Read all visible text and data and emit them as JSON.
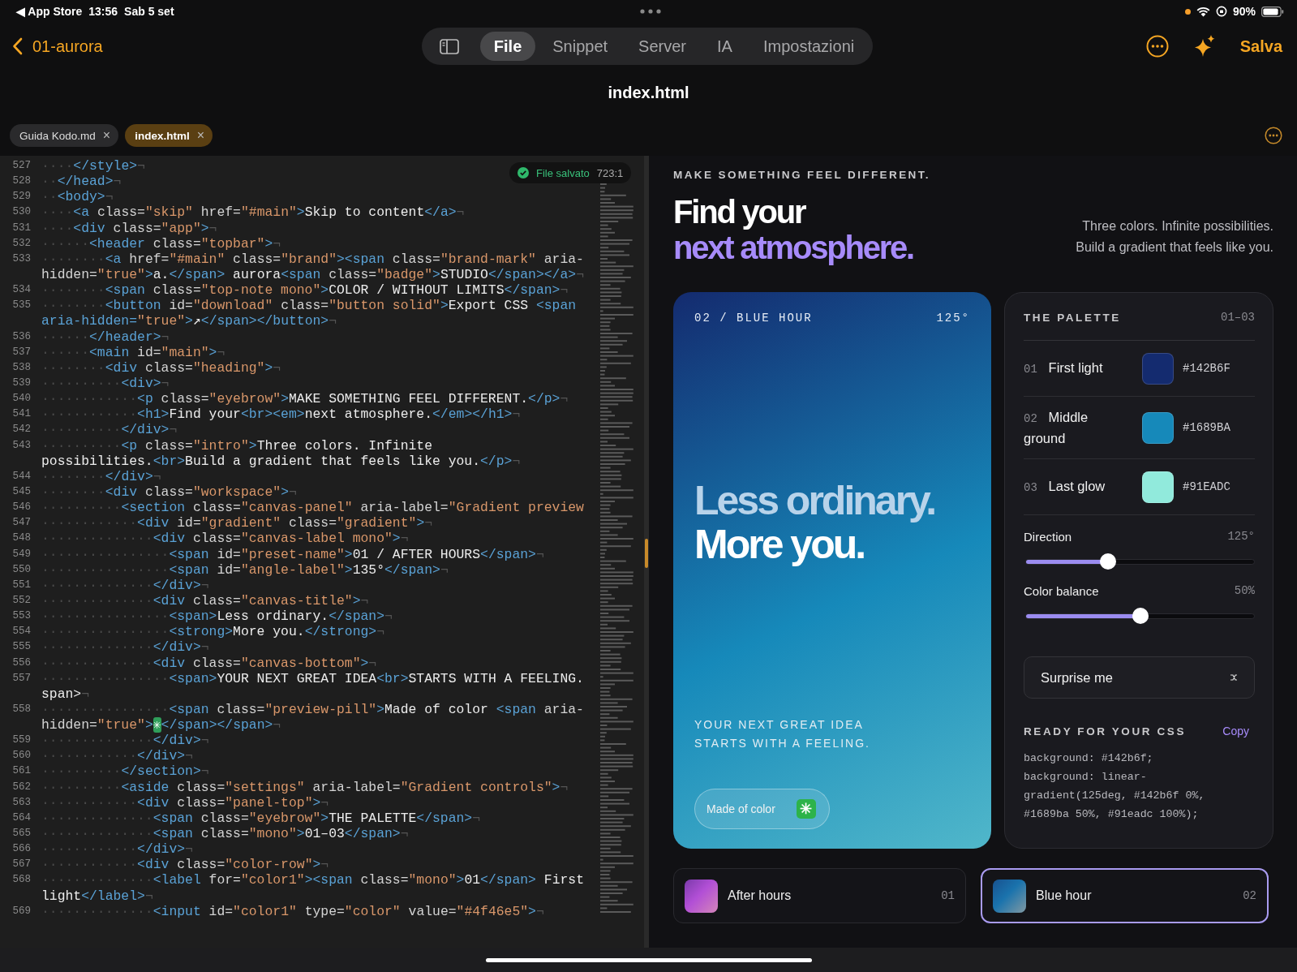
{
  "status_bar": {
    "back_app": "◀ App Store",
    "time": "13:56",
    "date": "Sab 5 set",
    "battery": "90%"
  },
  "nav": {
    "back": "01-aurora",
    "segments": [
      {
        "label": "File",
        "selected": true
      },
      {
        "label": "Snippet",
        "selected": false
      },
      {
        "label": "Server",
        "selected": false
      },
      {
        "label": "IA",
        "selected": false
      },
      {
        "label": "Impostazioni",
        "selected": false
      }
    ],
    "save": "Salva"
  },
  "title": "index.html",
  "file_tabs": [
    {
      "label": "Guida Kodo.md",
      "close": "×",
      "selected": false
    },
    {
      "label": "index.html",
      "close": "×",
      "selected": true
    }
  ],
  "editor": {
    "badge": {
      "text": "File salvato",
      "position": "723:1"
    },
    "lines": [
      {
        "n": "527",
        "rows": [
          "····</style>¬"
        ]
      },
      {
        "n": "528",
        "rows": [
          "··</head>¬"
        ]
      },
      {
        "n": "529",
        "rows": [
          "··<body>¬"
        ]
      },
      {
        "n": "530",
        "rows": [
          "····<a class=\"skip\" href=\"#main\">Skip to content</a>¬"
        ]
      },
      {
        "n": "531",
        "rows": [
          "····<div class=\"app\">¬"
        ]
      },
      {
        "n": "532",
        "rows": [
          "······<header class=\"topbar\">¬"
        ]
      },
      {
        "n": "533",
        "rows": [
          "········<a href=\"#main\" class=\"brand\"><span class=\"brand-mark\" aria-",
          "hidden=\"true\">a.</span> aurora<span class=\"badge\">STUDIO</span></a>¬"
        ]
      },
      {
        "n": "534",
        "rows": [
          "········<span class=\"top-note mono\">COLOR / WITHOUT LIMITS</span>¬"
        ]
      },
      {
        "n": "535",
        "rows": [
          "········<button id=\"download\" class=\"button solid\">Export CSS <span",
          "aria-hidden=\"true\">↗</span></button>¬"
        ]
      },
      {
        "n": "536",
        "rows": [
          "······</header>¬"
        ]
      },
      {
        "n": "537",
        "rows": [
          "······<main id=\"main\">¬"
        ]
      },
      {
        "n": "538",
        "rows": [
          "········<div class=\"heading\">¬"
        ]
      },
      {
        "n": "539",
        "rows": [
          "··········<div>¬"
        ]
      },
      {
        "n": "540",
        "rows": [
          "············<p class=\"eyebrow\">MAKE SOMETHING FEEL DIFFERENT.</p>¬"
        ]
      },
      {
        "n": "541",
        "rows": [
          "············<h1>Find your<br><em>next atmosphere.</em></h1>¬"
        ]
      },
      {
        "n": "542",
        "rows": [
          "··········</div>¬"
        ]
      },
      {
        "n": "543",
        "rows": [
          "··········<p class=\"intro\">Three colors. Infinite",
          "possibilities.<br>Build a gradient that feels like you.</p>¬"
        ]
      },
      {
        "n": "544",
        "rows": [
          "········</div>¬"
        ]
      },
      {
        "n": "545",
        "rows": [
          "········<div class=\"workspace\">¬"
        ]
      },
      {
        "n": "546",
        "rows": [
          "··········<section class=\"canvas-panel\" aria-label=\"Gradient preview"
        ]
      },
      {
        "n": "547",
        "rows": [
          "············<div id=\"gradient\" class=\"gradient\">¬"
        ]
      },
      {
        "n": "548",
        "rows": [
          "··············<div class=\"canvas-label mono\">¬"
        ]
      },
      {
        "n": "549",
        "rows": [
          "················<span id=\"preset-name\">01 / AFTER HOURS</span>¬"
        ]
      },
      {
        "n": "550",
        "rows": [
          "················<span id=\"angle-label\">135°</span>¬"
        ]
      },
      {
        "n": "551",
        "rows": [
          "··············</div>¬"
        ]
      },
      {
        "n": "552",
        "rows": [
          "··············<div class=\"canvas-title\">¬"
        ]
      },
      {
        "n": "553",
        "rows": [
          "················<span>Less ordinary.</span>¬"
        ]
      },
      {
        "n": "554",
        "rows": [
          "················<strong>More you.</strong>¬"
        ]
      },
      {
        "n": "555",
        "rows": [
          "··············</div>¬"
        ]
      },
      {
        "n": "556",
        "rows": [
          "··············<div class=\"canvas-bottom\">¬"
        ]
      },
      {
        "n": "557",
        "rows": [
          "················<span>YOUR NEXT GREAT IDEA<br>STARTS WITH A FEELING.",
          "span>¬"
        ]
      },
      {
        "n": "558",
        "rows": [
          "················<span class=\"preview-pill\">Made of color <span aria-",
          "hidden=\"true\">✳</span></span>¬"
        ]
      },
      {
        "n": "559",
        "rows": [
          "··············</div>¬"
        ]
      },
      {
        "n": "560",
        "rows": [
          "············</div>¬"
        ]
      },
      {
        "n": "561",
        "rows": [
          "··········</section>¬"
        ]
      },
      {
        "n": "562",
        "rows": [
          "··········<aside class=\"settings\" aria-label=\"Gradient controls\">¬"
        ]
      },
      {
        "n": "563",
        "rows": [
          "············<div class=\"panel-top\">¬"
        ]
      },
      {
        "n": "564",
        "rows": [
          "··············<span class=\"eyebrow\">THE PALETTE</span>¬"
        ]
      },
      {
        "n": "565",
        "rows": [
          "··············<span class=\"mono\">01–03</span>¬"
        ]
      },
      {
        "n": "566",
        "rows": [
          "············</div>¬"
        ]
      },
      {
        "n": "567",
        "rows": [
          "············<div class=\"color-row\">¬"
        ]
      },
      {
        "n": "568",
        "rows": [
          "··············<label for=\"color1\"><span class=\"mono\">01</span> First",
          "light</label>¬"
        ]
      },
      {
        "n": "569",
        "rows": [
          "··············<input id=\"color1\" type=\"color\" value=\"#4f46e5\">¬"
        ]
      }
    ]
  },
  "preview": {
    "eyebrow": "MAKE SOMETHING FEEL DIFFERENT.",
    "heading": "Find your",
    "heading_accent": "next atmosphere.",
    "intro": [
      "Three colors. Infinite possibilities.",
      "Build a gradient that feels like you."
    ],
    "canvas": {
      "label": "02 / BLUE HOUR",
      "angle": "125°",
      "title": "Less ordinary.",
      "title_strong": "More you.",
      "bottom": [
        "YOUR NEXT GREAT IDEA",
        "STARTS WITH A FEELING."
      ],
      "pill": "Made of color",
      "pill_icon": "✳"
    },
    "palette": {
      "title": "THE PALETTE",
      "range": "01–03",
      "colors": [
        {
          "index": "01",
          "name": "First light",
          "hex": "#142B6F",
          "color": "#142b6f"
        },
        {
          "index": "02",
          "name": "Middle ground",
          "hex": "#1689BA",
          "color": "#1689ba"
        },
        {
          "index": "03",
          "name": "Last glow",
          "hex": "#91EADC",
          "color": "#91eadc"
        }
      ],
      "sliders": [
        {
          "label": "Direction",
          "reading": "125°",
          "level": 0.36
        },
        {
          "label": "Color balance",
          "reading": "50%",
          "level": 0.5
        }
      ],
      "button": "Surprise me",
      "css": {
        "title": "READY FOR YOUR CSS",
        "copy": "Copy",
        "lines": [
          "background: #142b6f;",
          "background: linear-",
          "gradient(125deg, #142b6f 0%,",
          "#1689ba 50%, #91eadc 100%);"
        ]
      }
    },
    "presets": [
      {
        "name": "After hours",
        "index": "01",
        "selected": false,
        "color": "#b24fd6"
      },
      {
        "name": "Blue hour",
        "index": "02",
        "selected": true,
        "color": "#1a73ad"
      }
    ]
  }
}
